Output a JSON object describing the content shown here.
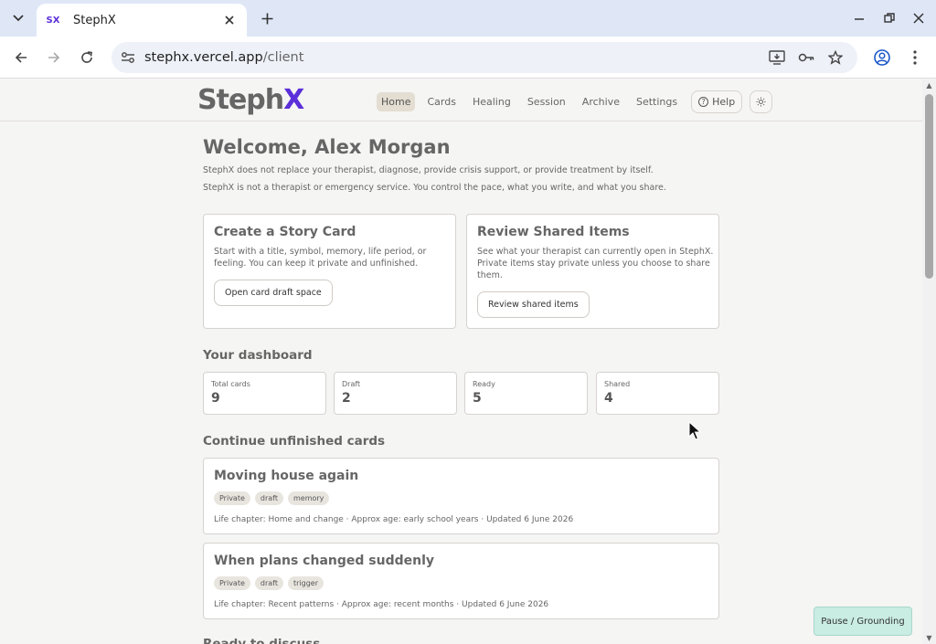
{
  "browser": {
    "tab": {
      "title": "StephX",
      "favicon": "SX"
    },
    "url": {
      "host": "stephx.vercel.app",
      "path": "/client"
    }
  },
  "site": {
    "logo": {
      "main": "Steph",
      "accent": "X"
    },
    "nav": [
      {
        "label": "Home",
        "active": true
      },
      {
        "label": "Cards",
        "active": false
      },
      {
        "label": "Healing",
        "active": false
      },
      {
        "label": "Session",
        "active": false
      },
      {
        "label": "Archive",
        "active": false
      },
      {
        "label": "Settings",
        "active": false
      }
    ],
    "help_label": "Help"
  },
  "welcome": {
    "title": "Welcome, Alex Morgan",
    "disclaimer1": "StephX does not replace your therapist, diagnose, provide crisis support, or provide treatment by itself.",
    "disclaimer2": "StephX is not a therapist or emergency service. You control the pace, what you write, and what you share."
  },
  "actions": {
    "create": {
      "title": "Create a Story Card",
      "desc_line1": "Start with a title, symbol, memory, life period, or",
      "desc_line2": "feeling. You can keep it private and unfinished.",
      "button": "Open card draft space"
    },
    "review": {
      "title": "Review Shared Items",
      "desc_line1": "See what your therapist can currently open in StephX.",
      "desc_line2": "Private items stay private unless you choose to share",
      "desc_line3": "them.",
      "button": "Review shared items"
    }
  },
  "dashboard": {
    "title": "Your dashboard",
    "stats": [
      {
        "label": "Total cards",
        "value": "9"
      },
      {
        "label": "Draft",
        "value": "2"
      },
      {
        "label": "Ready",
        "value": "5"
      },
      {
        "label": "Shared",
        "value": "4"
      }
    ]
  },
  "unfinished": {
    "title": "Continue unfinished cards",
    "items": [
      {
        "title": "Moving house again",
        "tags": [
          "Private",
          "draft",
          "memory"
        ],
        "meta": "Life chapter: Home and change · Approx age: early school years · Updated 6 June 2026"
      },
      {
        "title": "When plans changed suddenly",
        "tags": [
          "Private",
          "draft",
          "trigger"
        ],
        "meta": "Life chapter: Recent patterns · Approx age: recent months · Updated 6 June 2026"
      }
    ]
  },
  "next_section_title": "Ready to discuss",
  "pause_label": "Pause / Grounding",
  "colors": {
    "brand_accent": "#5b2fd9",
    "pause_bg": "#c9ece3",
    "active_nav_bg": "#e4ddd2"
  }
}
